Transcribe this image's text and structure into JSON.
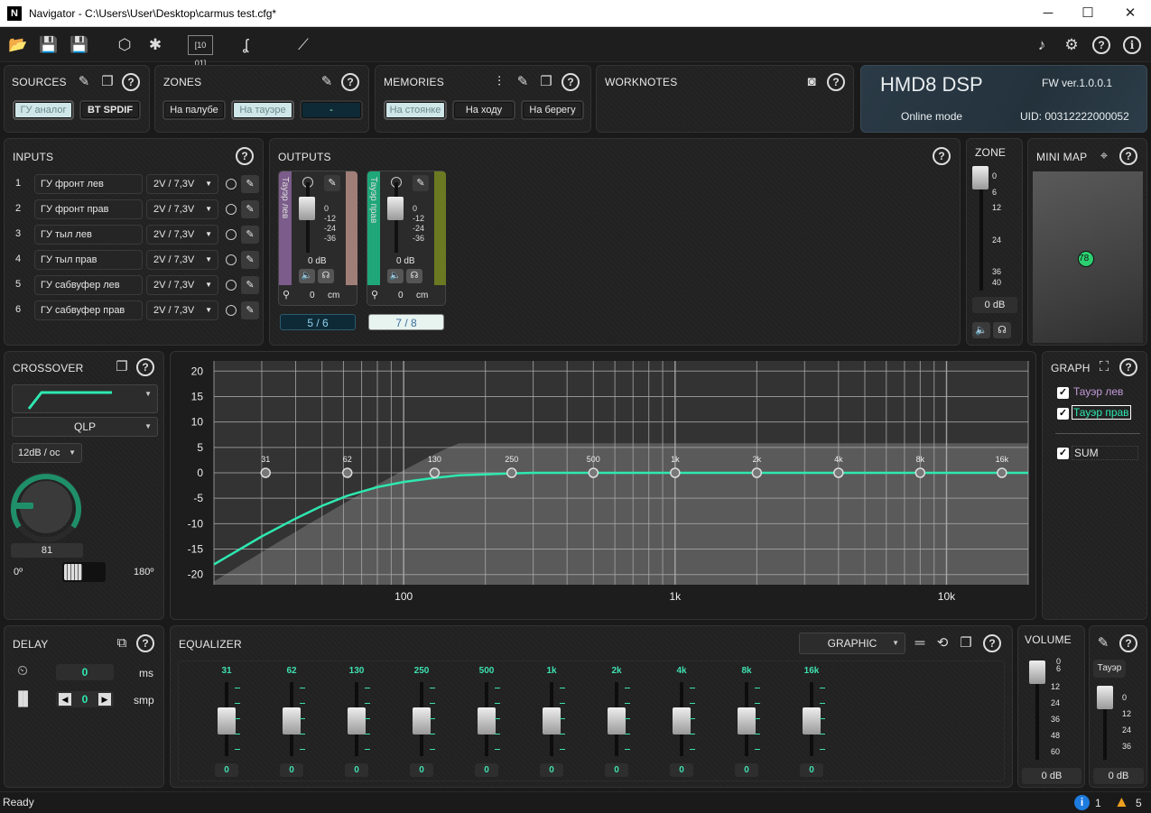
{
  "window": {
    "icon_letter": "N",
    "title": "Navigator - C:\\Users\\User\\Desktop\\carmus test.cfg*",
    "minimize": "─",
    "maximize": "☐",
    "close": "✕"
  },
  "toolbar": {
    "open": "📂",
    "save": "💾",
    "save_as": "💾",
    "chip": "⬡",
    "asterisk": "✱",
    "binary": "[10 01]",
    "probe": "ʆ",
    "wand": "⟋",
    "music": "♪",
    "settings": "⚙",
    "help": "?",
    "info": "i"
  },
  "help": "?",
  "sources": {
    "title": "SOURCES",
    "items": [
      "ГУ аналог",
      "BT SPDIF"
    ]
  },
  "zones": {
    "title": "ZONES",
    "items": [
      "На палубе",
      "На тауэре",
      "-"
    ]
  },
  "memories": {
    "title": "MEMORIES",
    "items": [
      "На стоянке",
      "На ходу",
      "На берегу"
    ]
  },
  "worknotes": {
    "title": "WORKNOTES"
  },
  "device": {
    "name": "HMD8 DSP",
    "fw": "FW ver.1.0.0.1",
    "mode": "Online mode",
    "uid": "UID: 00312222000052"
  },
  "inputs": {
    "title": "INPUTS",
    "rows": [
      {
        "n": "1",
        "name": "ГУ фронт лев",
        "level": "2V / 7,3V"
      },
      {
        "n": "2",
        "name": "ГУ фронт прав",
        "level": "2V / 7,3V"
      },
      {
        "n": "3",
        "name": "ГУ тыл лев",
        "level": "2V / 7,3V"
      },
      {
        "n": "4",
        "name": "ГУ тыл прав",
        "level": "2V / 7,3V"
      },
      {
        "n": "5",
        "name": "ГУ сабвуфер лев",
        "level": "2V / 7,3V"
      },
      {
        "n": "6",
        "name": "ГУ сабвуфер прав",
        "level": "2V / 7,3V"
      }
    ]
  },
  "outputs": {
    "title": "OUTPUTS",
    "scale": [
      "0",
      "-12",
      "-24",
      "-36"
    ],
    "channels": [
      {
        "name": "Тауэр лев",
        "gain": "0 dB",
        "delay": "0",
        "unit": "cm",
        "routing": "5 / 6",
        "color": "#7b5c8a",
        "color2": "#a07e78"
      },
      {
        "name": "Тауэр прав",
        "gain": "0 dB",
        "delay": "0",
        "unit": "cm",
        "routing": "7 / 8",
        "color": "#1fa77a",
        "color2": "#6b7a22"
      }
    ]
  },
  "zone": {
    "title": "ZONE",
    "scale": [
      "0",
      "6",
      "12",
      "24",
      "36",
      "40"
    ],
    "value": "0 dB"
  },
  "minimap": {
    "title": "MINI MAP",
    "marker_a": "7",
    "marker_b": "8"
  },
  "crossover": {
    "title": "CROSSOVER",
    "filter": "QLP",
    "slope": "12dB / oc",
    "phase_value": "81",
    "phase_min": "0º",
    "phase_max": "180º"
  },
  "graph": {
    "title": "GRAPH",
    "channels": [
      {
        "label": "Тауэр лев",
        "color": "#c39ad9",
        "checked": true
      },
      {
        "label": "Тауэр прав",
        "color": "#2ee8b0",
        "checked": true
      }
    ],
    "sum": "SUM",
    "curve_color": "#2ee8b0"
  },
  "chart_data": {
    "type": "line",
    "xscale": "log",
    "xlim": [
      20,
      20000
    ],
    "ylim": [
      -22,
      22
    ],
    "yticks": [
      "20",
      "15",
      "10",
      "5",
      "0",
      "-5",
      "-10",
      "-15",
      "-20"
    ],
    "xtick_labels": [
      "100",
      "1k",
      "10k"
    ],
    "band_labels": [
      "31",
      "62",
      "130",
      "250",
      "500",
      "1k",
      "2k",
      "4k",
      "8k",
      "16k"
    ],
    "band_freqs": [
      31,
      62,
      130,
      250,
      500,
      1000,
      2000,
      4000,
      8000,
      16000
    ],
    "series": [
      {
        "name": "Тауэр прав",
        "x": [
          20,
          30,
          40,
          50,
          62,
          80,
          100,
          130,
          160,
          200,
          250,
          300,
          400,
          500,
          1000,
          5000,
          20000
        ],
        "y": [
          -18,
          -12.5,
          -9,
          -6.5,
          -4.5,
          -2.8,
          -1.8,
          -1,
          -0.5,
          -0.3,
          -0.1,
          0,
          0,
          0,
          0,
          0,
          0
        ]
      }
    ]
  },
  "delay": {
    "title": "DELAY",
    "ms": "0",
    "ms_unit": "ms",
    "smp": "0",
    "smp_unit": "smp"
  },
  "equalizer": {
    "title": "EQUALIZER",
    "mode": "GRAPHIC",
    "bands": [
      {
        "f": "31",
        "v": "0"
      },
      {
        "f": "62",
        "v": "0"
      },
      {
        "f": "130",
        "v": "0"
      },
      {
        "f": "250",
        "v": "0"
      },
      {
        "f": "500",
        "v": "0"
      },
      {
        "f": "1k",
        "v": "0"
      },
      {
        "f": "2k",
        "v": "0"
      },
      {
        "f": "4k",
        "v": "0"
      },
      {
        "f": "8k",
        "v": "0"
      },
      {
        "f": "16k",
        "v": "0"
      }
    ]
  },
  "volume": {
    "title": "VOLUME",
    "scale": [
      "0",
      "6",
      "12",
      "24",
      "36",
      "48",
      "60"
    ],
    "value": "0 dB"
  },
  "out_volume": {
    "tab": "Тауэр",
    "scale": [
      "0",
      "12",
      "24",
      "36"
    ],
    "value": "0 dB"
  },
  "status": {
    "text": "Ready",
    "info_count": "1",
    "warn_count": "5"
  }
}
